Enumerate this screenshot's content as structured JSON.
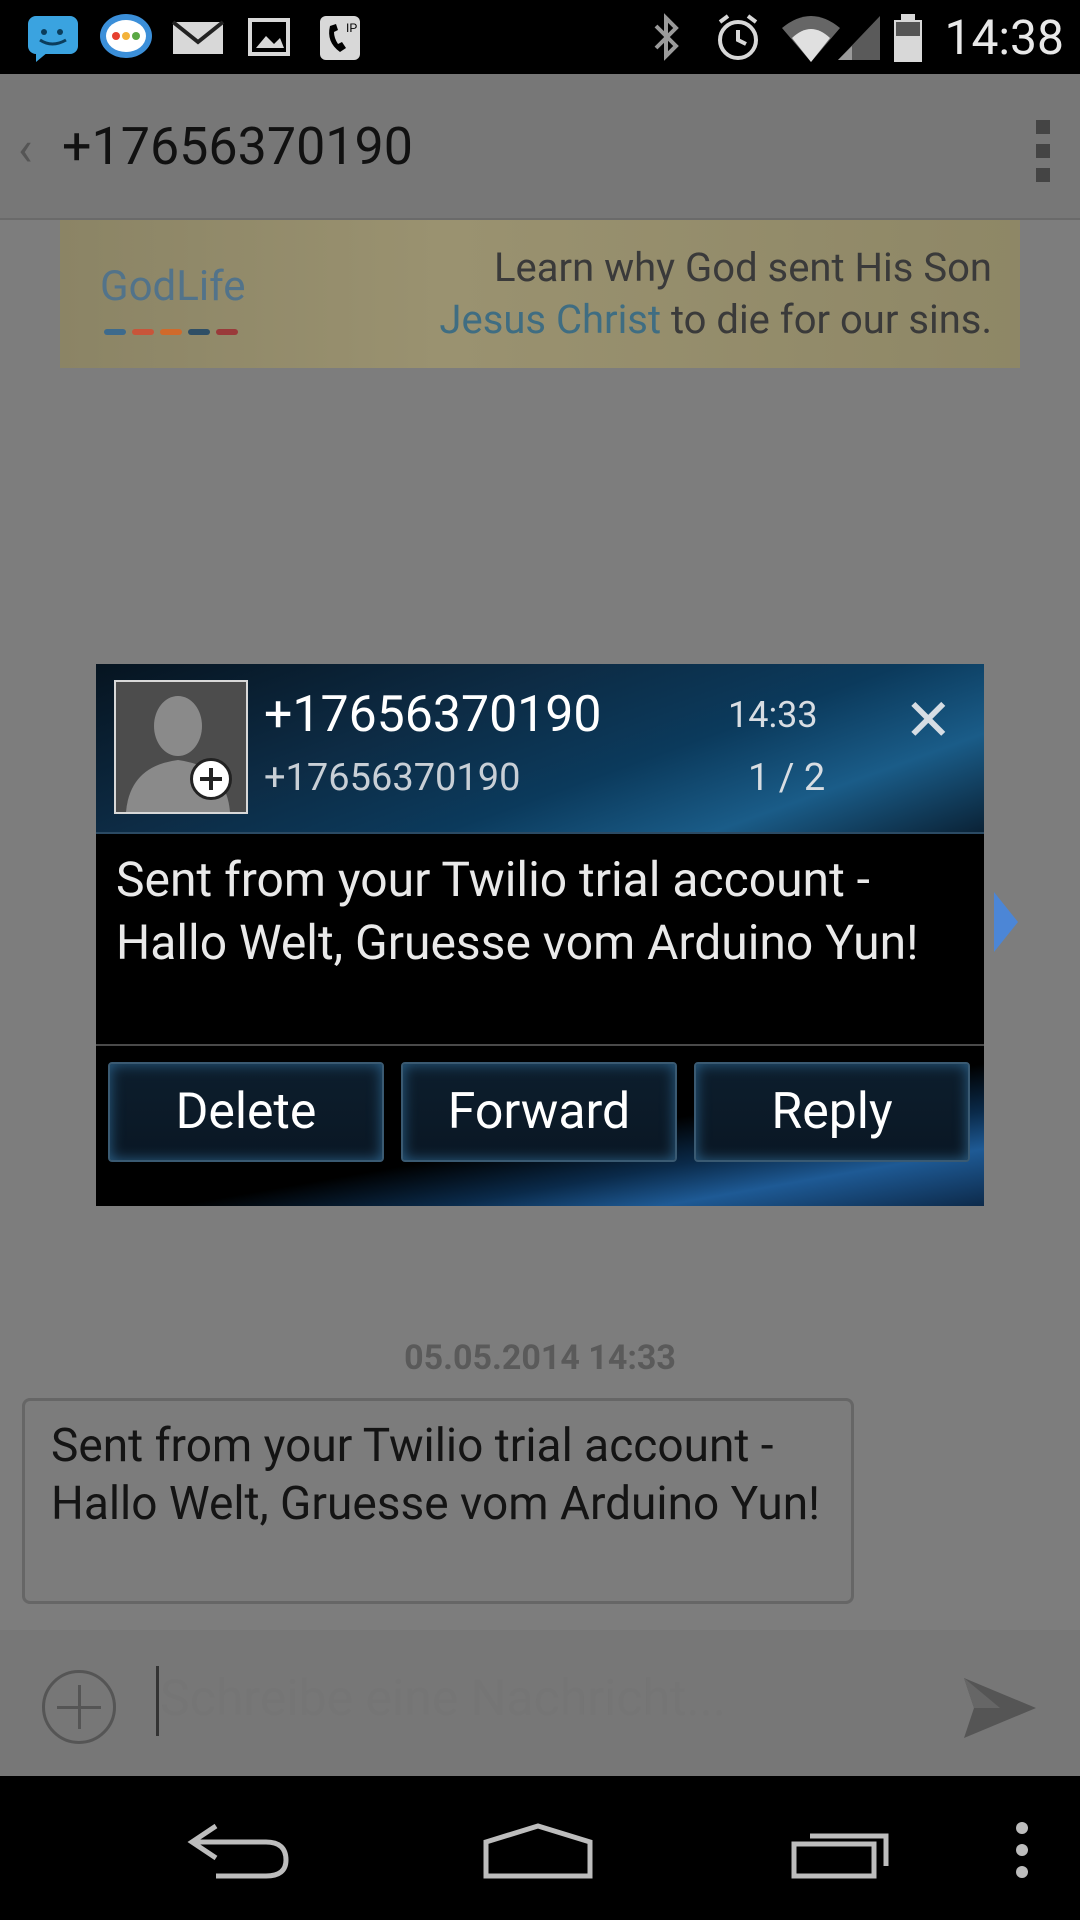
{
  "status_bar": {
    "time": "14:38",
    "left_icons": [
      "messenger-icon",
      "chat-bubble-icon",
      "mail-icon",
      "image-icon",
      "ip-phone-icon"
    ],
    "right_icons": [
      "bluetooth-icon",
      "alarm-icon",
      "wifi-icon",
      "signal-icon",
      "battery-icon"
    ]
  },
  "app_bar": {
    "title": "+17656370190"
  },
  "ad": {
    "logo_a": "God",
    "logo_b": "Life",
    "line1": "Learn why God sent His Son",
    "line2_highlight": "Jesus Christ",
    "line2_rest": " to die for our sins."
  },
  "popup": {
    "name": "+17656370190",
    "number": "+17656370190",
    "time": "14:33",
    "count": "1 / 2",
    "close": "✕",
    "message": "Sent from your Twilio trial account - Hallo Welt, Gruesse vom Arduino Yun!",
    "buttons": {
      "delete": "Delete",
      "forward": "Forward",
      "reply": "Reply"
    }
  },
  "conversation": {
    "date": "05.05.2014 14:33",
    "message": "Sent from your Twilio trial account - Hallo Welt, Gruesse vom Arduino Yun!"
  },
  "composer": {
    "placeholder": "Schreibe eine Nachricht..."
  },
  "nav": {
    "icons": [
      "back-icon",
      "home-icon",
      "recents-icon",
      "menu-icon"
    ]
  }
}
